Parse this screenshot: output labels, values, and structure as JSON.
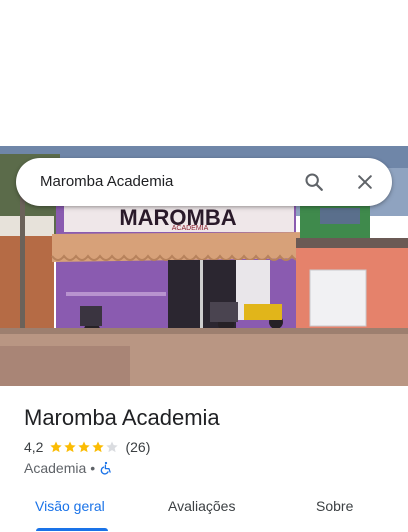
{
  "search": {
    "query": "Maromba Academia",
    "search_icon": "search-icon",
    "close_icon": "close-icon"
  },
  "place": {
    "name": "Maromba Academia",
    "rating": "4,2",
    "rating_value": 4.2,
    "stars_filled": 4,
    "stars_total": 5,
    "review_count": "(26)",
    "category": "Academia",
    "separator": "•",
    "accessibility_icon": "wheelchair-icon"
  },
  "photo": {
    "sign_text": "MAROMBA",
    "sign_subtext": "ACADEMIA"
  },
  "tabs": [
    {
      "label": "Visão geral",
      "active": true
    },
    {
      "label": "Avaliações",
      "active": false
    },
    {
      "label": "Sobre",
      "active": false
    }
  ],
  "colors": {
    "accent": "#1a73e8",
    "star": "#fbbc04",
    "star_empty": "#dadce0",
    "awning": "#d9a27a",
    "wall_purple": "#7b4fa3",
    "wall_salmon": "#e6816a"
  }
}
